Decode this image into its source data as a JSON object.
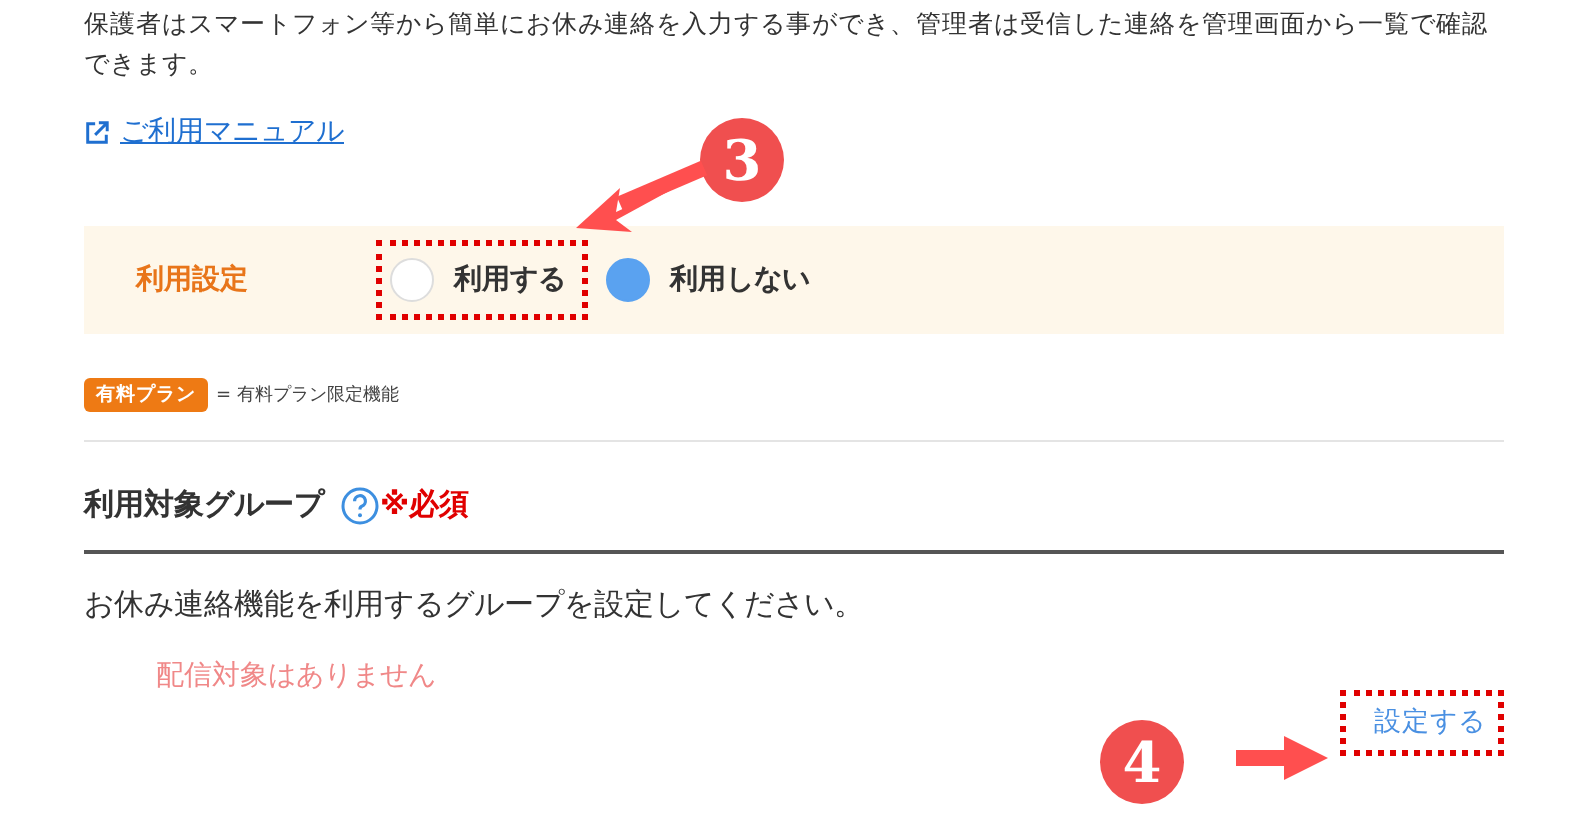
{
  "description": "保護者はスマートフォン等から簡単にお休み連絡を入力する事ができ、管理者は受信した連絡を管理画面から一覧で確認できます。",
  "manual_link": "ご利用マニュアル",
  "usage_setting": {
    "label": "利用設定",
    "options": [
      {
        "label": "利用する",
        "selected": false,
        "kind": "framed"
      },
      {
        "label": "利用しない",
        "selected": true,
        "kind": "plain"
      }
    ]
  },
  "plan_legend": {
    "badge": "有料プラン",
    "text": "= 有料プラン限定機能"
  },
  "target_group": {
    "heading": "利用対象グループ",
    "required": "※必須",
    "instruction": "お休み連絡機能を利用するグループを設定してください。",
    "empty_message": "配信対象はありません",
    "button": "設定する",
    "button_highlighted": true
  },
  "step_markers": [
    {
      "number": "3",
      "kind": "upper"
    },
    {
      "number": "4",
      "kind": "lower"
    }
  ]
}
